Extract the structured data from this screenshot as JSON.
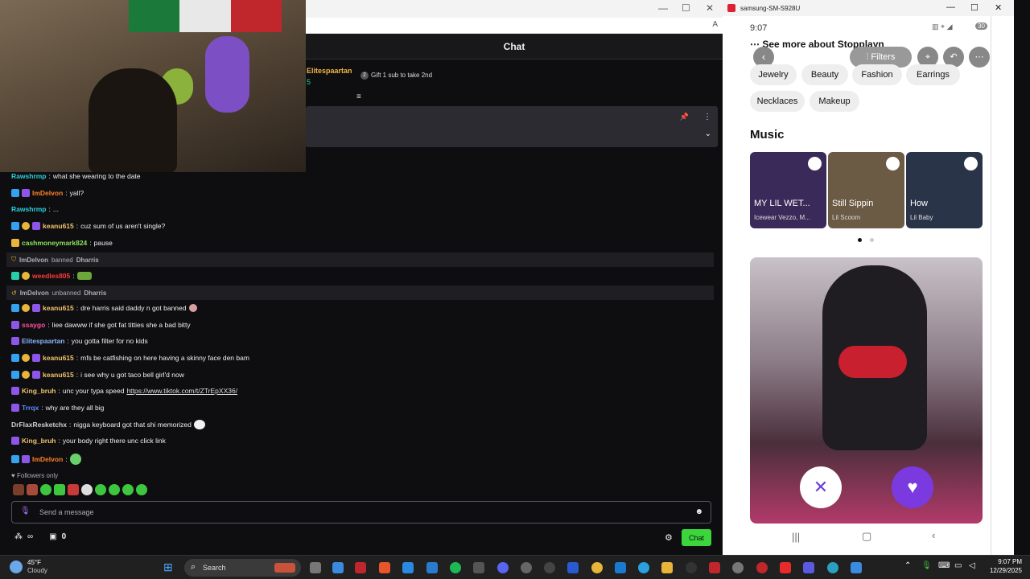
{
  "webcam": {
    "flag_colors": [
      "#1b7a3a",
      "#e8e8e8",
      "#c0272d"
    ]
  },
  "browser": {
    "chat_header": "Chat",
    "gifter_name": "Elitespaartan",
    "gifter_count": "5",
    "gift_text": "Gift 1 sub to take 2nd",
    "gift_count": "2"
  },
  "chat": {
    "messages": [
      {
        "user": "Rawshrmp",
        "color": "#2ccfdc",
        "text": "what she wearing to the date"
      },
      {
        "user": "ImDelvon",
        "color": "#ff7f27",
        "text": "yall?"
      },
      {
        "user": "Rawshrmp",
        "color": "#2ccfdc",
        "text": "..."
      },
      {
        "user": "keanu615",
        "color": "#f0c36d",
        "text": "cuz sum of us aren't single?"
      },
      {
        "user": "cashmoneymark824",
        "color": "#8fe35a",
        "text": "pause"
      },
      {
        "user": "weedles805",
        "color": "#ff3b3b",
        "text": ""
      },
      {
        "user": "keanu615",
        "color": "#f0c36d",
        "text": "dre harris said daddy n got banned"
      },
      {
        "user": "ssaygo",
        "color": "#ff4fa0",
        "text": "liee dawww if she got fat titties she a bad bitty"
      },
      {
        "user": "Elitespaartan",
        "color": "#8ab4ff",
        "text": "you gotta filter for no kids"
      },
      {
        "user": "keanu615",
        "color": "#f0c36d",
        "text": "mfs be catfishing on here having a skinny face den bam"
      },
      {
        "user": "keanu615",
        "color": "#f0c36d",
        "text": "i see why u got taco bell girl'd now"
      },
      {
        "user": "King_bruh",
        "color": "#f0c36d",
        "text": "unc your typa speed"
      },
      {
        "user": "Trrqx",
        "color": "#5b8cff",
        "text": "why are they all big"
      },
      {
        "user": "DrFlaxResketchx",
        "color": "#cfcfcf",
        "text": "nigga keyboard got that shi memorized"
      },
      {
        "user": "King_bruh",
        "color": "#f0c36d",
        "text": "your body right there unc click link"
      },
      {
        "user": "ImDelvon",
        "color": "#ff7f27",
        "text": ""
      }
    ],
    "link": "https://www.tiktok.com/t/ZTrEpXX36/",
    "mod_action_1": {
      "mod": "ImDelvon",
      "action": "banned",
      "target": "Dharris"
    },
    "mod_action_2": {
      "mod": "ImDelvon",
      "action": "unbanned",
      "target": "Dharris"
    },
    "followers_only": "Followers only",
    "input_placeholder": "Send a message",
    "points": "0",
    "chat_button": "Chat"
  },
  "phone": {
    "window_title": "samsung-SM-S928U",
    "time": "9:07",
    "battery": "30",
    "see_more": "See more about Stopplayn",
    "filters_label": "Filters",
    "chips_row1": [
      "Jewelry",
      "Beauty",
      "Fashion",
      "Earrings"
    ],
    "chips_row2": [
      "Necklaces",
      "Makeup"
    ],
    "music_heading": "Music",
    "songs": [
      {
        "title": "MY LIL WET...",
        "artist": "Icewear Vezzo, M...",
        "color": "#3a2a5a"
      },
      {
        "title": "Still Sippin",
        "artist": "Lil Scoom",
        "color": "#6b5a44"
      },
      {
        "title": "How",
        "artist": "Lil Baby",
        "color": "#2a3448"
      }
    ]
  },
  "taskbar": {
    "weather_temp": "45°F",
    "weather_desc": "Cloudy",
    "search_placeholder": "Search",
    "clock_time": "9:07 PM",
    "clock_date": "12/29/2025"
  }
}
